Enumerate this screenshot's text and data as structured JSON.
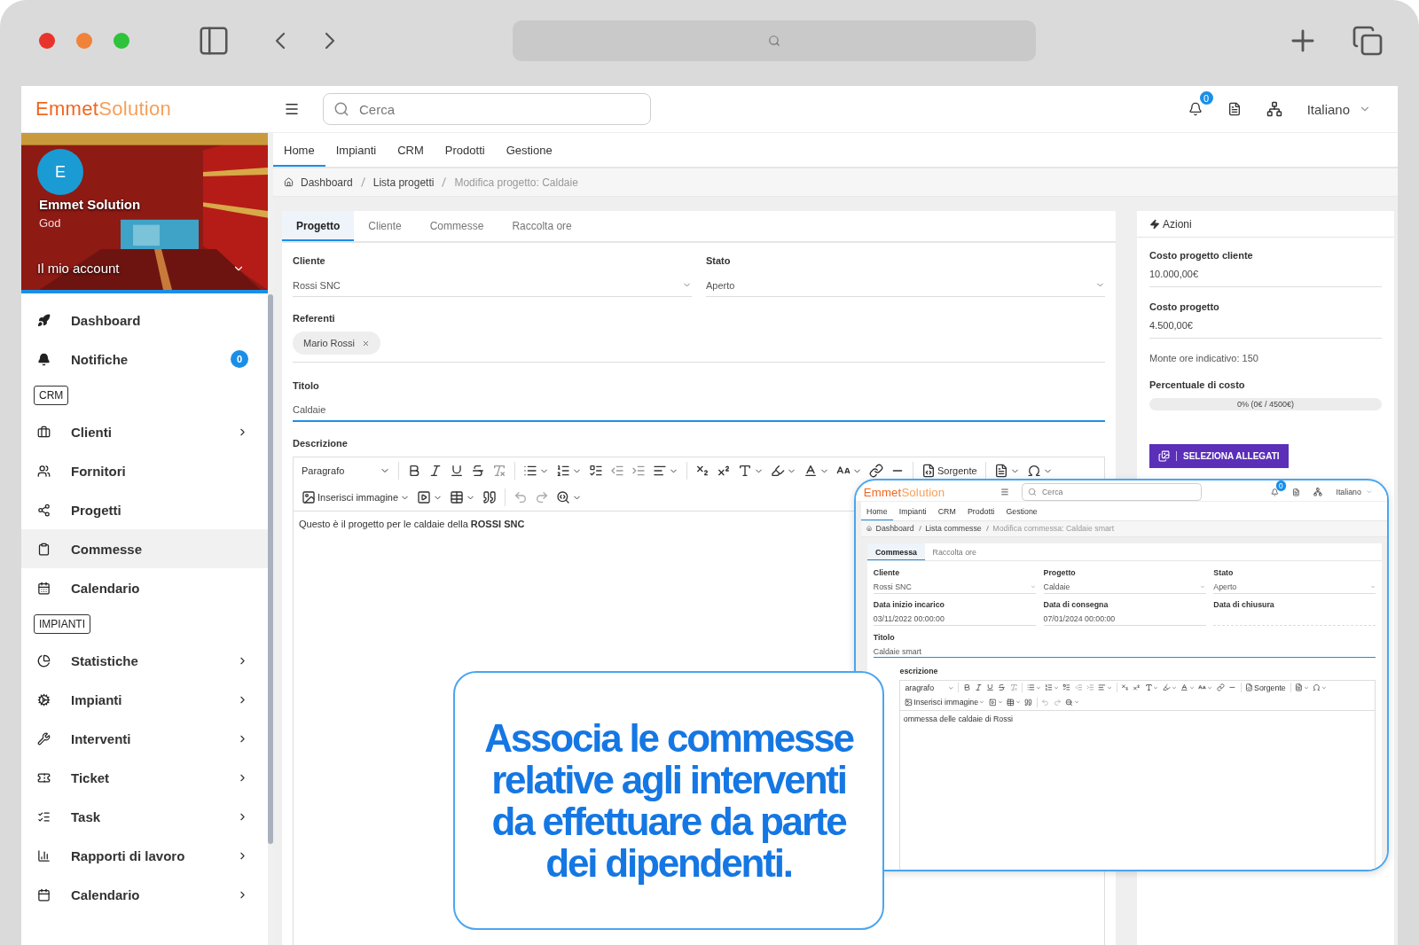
{
  "app": {
    "logo": {
      "part1": "Emmet",
      "part2": "Solution"
    },
    "search": {
      "placeholder": "Cerca"
    },
    "notifications_badge": "0",
    "language": "Italiano"
  },
  "profile": {
    "initial": "E",
    "name": "Emmet Solution",
    "role": "God",
    "account_label": "Il mio account"
  },
  "sidebar": {
    "items": [
      {
        "kind": "link",
        "label": "Dashboard",
        "selected": false,
        "submenu": false
      },
      {
        "kind": "link",
        "label": "Notifiche",
        "selected": false,
        "submenu": false,
        "badge": "0"
      },
      {
        "kind": "heading",
        "label": "CRM"
      },
      {
        "kind": "link",
        "label": "Clienti",
        "selected": false,
        "submenu": true
      },
      {
        "kind": "link",
        "label": "Fornitori",
        "selected": false,
        "submenu": false
      },
      {
        "kind": "link",
        "label": "Progetti",
        "selected": false,
        "submenu": false
      },
      {
        "kind": "link",
        "label": "Commesse",
        "selected": true,
        "submenu": false
      },
      {
        "kind": "link",
        "label": "Calendario",
        "selected": false,
        "submenu": false
      },
      {
        "kind": "heading",
        "label": "IMPIANTI"
      },
      {
        "kind": "link",
        "label": "Statistiche",
        "selected": false,
        "submenu": true
      },
      {
        "kind": "link",
        "label": "Impianti",
        "selected": false,
        "submenu": true
      },
      {
        "kind": "link",
        "label": "Interventi",
        "selected": false,
        "submenu": true
      },
      {
        "kind": "link",
        "label": "Ticket",
        "selected": false,
        "submenu": true
      },
      {
        "kind": "link",
        "label": "Task",
        "selected": false,
        "submenu": true
      },
      {
        "kind": "link",
        "label": "Rapporti di lavoro",
        "selected": false,
        "submenu": true
      },
      {
        "kind": "link",
        "label": "Calendario",
        "selected": false,
        "submenu": true
      }
    ]
  },
  "nav_tabs": [
    {
      "label": "Home",
      "selected": true
    },
    {
      "label": "Impianti",
      "selected": false
    },
    {
      "label": "CRM",
      "selected": false
    },
    {
      "label": "Prodotti",
      "selected": false
    },
    {
      "label": "Gestione",
      "selected": false
    }
  ],
  "breadcrumb": [
    "Dashboard",
    "Lista progetti",
    "Modifica progetto: Caldaie"
  ],
  "form": {
    "tabs": [
      {
        "label": "Progetto",
        "selected": true
      },
      {
        "label": "Cliente",
        "selected": false
      },
      {
        "label": "Commesse",
        "selected": false
      },
      {
        "label": "Raccolta ore",
        "selected": false
      }
    ],
    "fields": [
      {
        "kind": "select",
        "label": "Cliente",
        "value": "Rossi SNC"
      },
      {
        "kind": "select",
        "label": "Stato",
        "value": "Aperto"
      }
    ],
    "referenti": {
      "label": "Referenti",
      "chips": [
        "Mario Rossi"
      ]
    },
    "titolo": {
      "label": "Titolo",
      "value": "Caldaie",
      "focused": true
    },
    "descrizione": {
      "label": "Descrizione",
      "block_style": "Paragrafo",
      "source_label": "Sorgente",
      "image_label": "Inserisci immagine",
      "content": "Questo è il progetto per le caldaie della **ROSSI SNC**"
    }
  },
  "panel": {
    "title": "Azioni",
    "fields": [
      {
        "label": "Costo progetto cliente",
        "value": "10.000,00€"
      },
      {
        "label": "Costo progetto",
        "value": "4.500,00€"
      }
    ],
    "note": "Monte ore indicativo: 150",
    "progress": {
      "label": "Percentuale di costo",
      "level": 0,
      "reading": "0% (0€ / 4500€)"
    },
    "button": "SELEZIONA ALLEGATI"
  },
  "inset": {
    "app": {
      "logo": {
        "part1": "Emmet",
        "part2": "Solution"
      },
      "search": {
        "placeholder": "Cerca"
      },
      "notifications_badge": "0",
      "language": "Italiano"
    },
    "nav_tabs": [
      {
        "label": "Home",
        "selected": true
      },
      {
        "label": "Impianti",
        "selected": false
      },
      {
        "label": "CRM",
        "selected": false
      },
      {
        "label": "Prodotti",
        "selected": false
      },
      {
        "label": "Gestione",
        "selected": false
      }
    ],
    "breadcrumb": [
      "Dashboard",
      "Lista commesse",
      "Modifica commessa: Caldaie smart"
    ],
    "tabs": [
      {
        "label": "Commessa",
        "selected": true
      },
      {
        "label": "Raccolta ore",
        "selected": false
      }
    ],
    "fields": [
      {
        "kind": "select",
        "label": "Cliente",
        "value": "Rossi SNC"
      },
      {
        "kind": "select",
        "label": "Progetto",
        "value": "Caldaie"
      },
      {
        "kind": "select",
        "label": "Stato",
        "value": "Aperto"
      },
      {
        "kind": "date",
        "label": "Data inizio incarico",
        "value": "03/11/2022 00:00:00"
      },
      {
        "kind": "date",
        "label": "Data di consegna",
        "value": "07/01/2024 00:00:00"
      },
      {
        "kind": "date",
        "label": "Data di chiusura"
      }
    ],
    "titolo": {
      "label": "Titolo",
      "value": "Caldaie smart",
      "focused": true
    },
    "descrizione": {
      "label": "escrizione",
      "block_style": "aragrafo",
      "source_label": "Sorgente",
      "image_label": "Inserisci immagine",
      "content": "ommessa delle caldaie di Rossi"
    }
  },
  "callout": {
    "text": "Associa le commesse relative agli interventi da effettuare da parte dei dipendenti."
  }
}
